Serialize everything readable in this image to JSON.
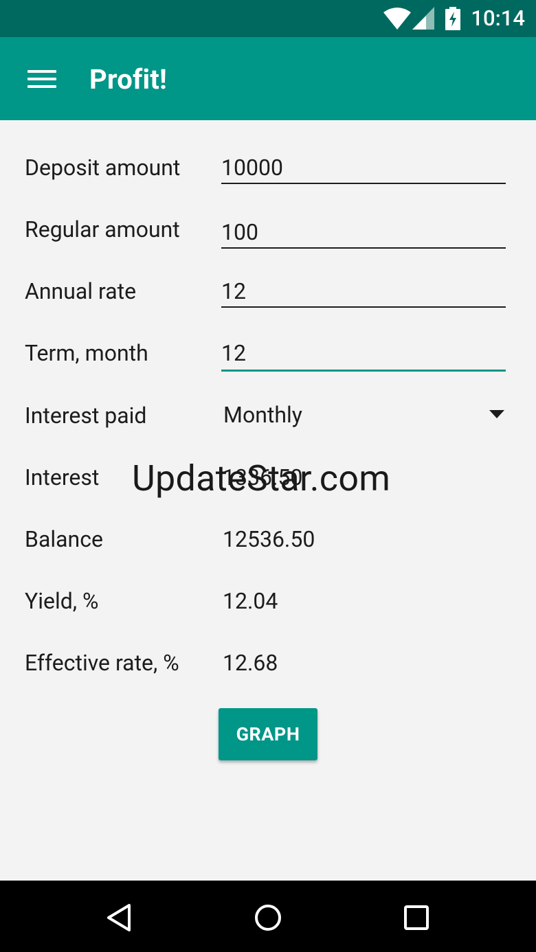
{
  "status_bar": {
    "time": "10:14",
    "icons": [
      "wifi-icon",
      "signal-icon",
      "battery-charging-icon"
    ]
  },
  "app_bar": {
    "title": "Profit!",
    "menu_icon": "hamburger-menu-icon"
  },
  "form": {
    "deposit": {
      "label": "Deposit amount",
      "value": "10000"
    },
    "regular": {
      "label": "Regular amount",
      "value": "100"
    },
    "rate": {
      "label": "Annual rate",
      "value": "12"
    },
    "term": {
      "label": "Term, month",
      "value": "12"
    },
    "interest_paid": {
      "label": "Interest paid",
      "value": "Monthly"
    }
  },
  "results": {
    "interest": {
      "label": "Interest",
      "value": "1336.50"
    },
    "balance": {
      "label": "Balance",
      "value": "12536.50"
    },
    "yield": {
      "label": "Yield, %",
      "value": "12.04"
    },
    "effective_rate": {
      "label": "Effective rate, %",
      "value": "12.68"
    }
  },
  "graph_button": {
    "label": "GRAPH"
  },
  "watermark": "UpdateStar.com",
  "nav_bar": {
    "icons": [
      "back-icon",
      "home-icon",
      "recents-icon"
    ]
  },
  "colors": {
    "primary": "#009688",
    "primary_dark": "#00695f",
    "background": "#f3f3f3",
    "text": "#1c1c1c"
  }
}
